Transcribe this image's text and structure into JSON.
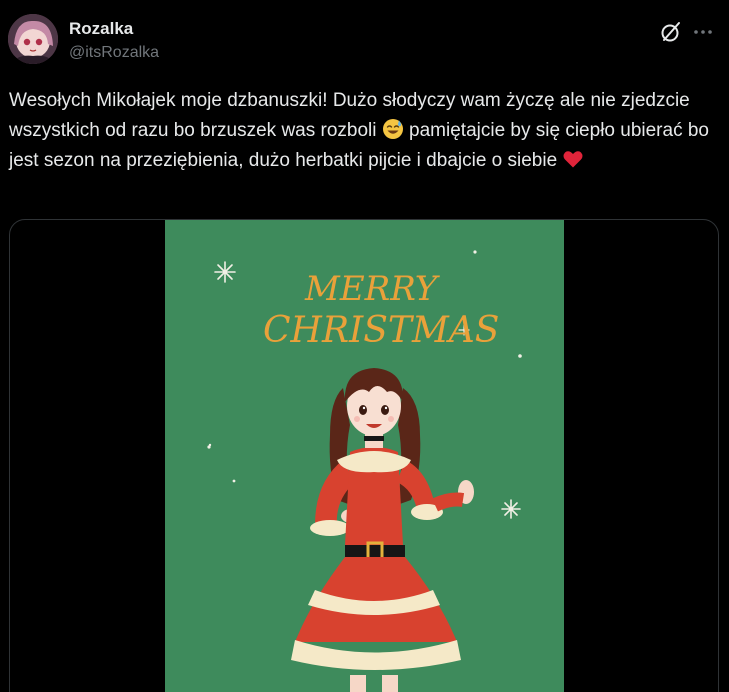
{
  "author": {
    "display_name": "Rozalka",
    "handle": "@itsRozalka"
  },
  "icons": {
    "grok": "grok-icon",
    "more": "more-icon",
    "sweat_smile": "sweat-smile-emoji",
    "heart": "red-heart-emoji"
  },
  "tweet": {
    "text_part1": "Wesołych Mikołajek moje dzbanuszki! Dużo słodyczy wam życzę ale nie zjedzcie wszystkich od razu bo brzuszek was rozboli ",
    "text_part2": " pamiętajcie by się ciepło ubierać bo jest sezon na przeziębienia, dużo herbatki pijcie i dbajcie o siebie "
  },
  "media": {
    "headline_line1": "MERRY",
    "headline_line2": "CHRISTMAS",
    "background_color": "#3e8b5c",
    "lettering_color": "#e9a13a"
  }
}
